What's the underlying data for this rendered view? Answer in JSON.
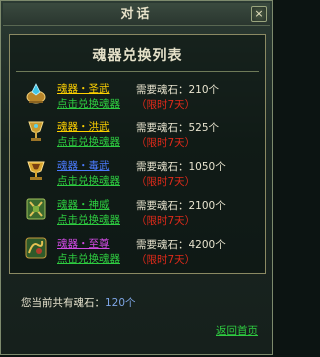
{
  "window": {
    "title": "对话",
    "close_glyph": "×"
  },
  "panel": {
    "heading": "魂器兑换列表"
  },
  "need_label": "需要魂石：",
  "items": [
    {
      "name": "魂器・圣武",
      "name_color": "#ffd100",
      "redeem": "点击兑换魂器",
      "cost": "210个",
      "limit": "（限时7天）",
      "icon": "crystal-cauldron-icon"
    },
    {
      "name": "魂器・洪武",
      "name_color": "#ffd100",
      "redeem": "点击兑换魂器",
      "cost": "525个",
      "limit": "（限时7天）",
      "icon": "goblet-icon"
    },
    {
      "name": "魂器・毒武",
      "name_color": "#4b7bff",
      "redeem": "点击兑换魂器",
      "cost": "1050个",
      "limit": "（限时7天）",
      "icon": "chalice-icon"
    },
    {
      "name": "魂器・神威",
      "name_color": "#2ecc40",
      "redeem": "点击兑换魂器",
      "cost": "2100个",
      "limit": "（限时7天）",
      "icon": "scroll-tablet-icon"
    },
    {
      "name": "魂器・至尊",
      "name_color": "#d24be4",
      "redeem": "点击兑换魂器",
      "cost": "4200个",
      "limit": "（限时7天）",
      "icon": "dragon-emblem-icon"
    }
  ],
  "footer": {
    "owned_label": "您当前共有魂石：",
    "owned_value": "120个",
    "back": "返回首页"
  }
}
